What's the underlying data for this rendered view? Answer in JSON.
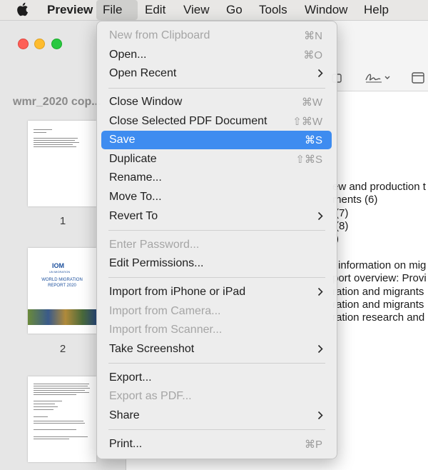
{
  "menubar": {
    "app": "Preview",
    "items": [
      "File",
      "Edit",
      "View",
      "Go",
      "Tools",
      "Window",
      "Help"
    ]
  },
  "window": {
    "doc_title": "wmr_2020 cop...",
    "thumbnails": [
      "1",
      "2"
    ],
    "cover_lines": [
      "IOM",
      "UN MIGRATION",
      "WORLD MIGRATION",
      "REPORT 2020"
    ]
  },
  "content_lines": [
    "ew and production t",
    "ments (6)",
    "(7)",
    "(8)",
    ")",
    "information on mig",
    "port overview: Provi",
    "ration and migrants",
    "ration and migrants",
    "ration research and"
  ],
  "file_menu": {
    "items": [
      {
        "label": "New from Clipboard",
        "shortcut": "⌘N",
        "disabled": true
      },
      {
        "label": "Open...",
        "shortcut": "⌘O"
      },
      {
        "label": "Open Recent",
        "submenu": true
      },
      {
        "label": "Close Window",
        "shortcut": "⌘W"
      },
      {
        "label": "Close Selected PDF Document",
        "shortcut": "⇧⌘W"
      },
      {
        "label": "Save",
        "shortcut": "⌘S",
        "highlighted": true
      },
      {
        "label": "Duplicate",
        "shortcut": "⇧⌘S"
      },
      {
        "label": "Rename..."
      },
      {
        "label": "Move To..."
      },
      {
        "label": "Revert To",
        "submenu": true
      },
      {
        "label": "Enter Password...",
        "disabled": true
      },
      {
        "label": "Edit Permissions..."
      },
      {
        "label": "Import from iPhone or iPad",
        "submenu": true
      },
      {
        "label": "Import from Camera...",
        "disabled": true
      },
      {
        "label": "Import from Scanner...",
        "disabled": true
      },
      {
        "label": "Take Screenshot",
        "submenu": true
      },
      {
        "label": "Export..."
      },
      {
        "label": "Export as PDF...",
        "disabled": true
      },
      {
        "label": "Share",
        "submenu": true
      },
      {
        "label": "Print...",
        "shortcut": "⌘P"
      }
    ]
  },
  "colors": {
    "highlight": "#3e8cf0",
    "traffic_red": "#fe5f57",
    "traffic_yellow": "#febc2e",
    "traffic_green": "#28c840"
  }
}
